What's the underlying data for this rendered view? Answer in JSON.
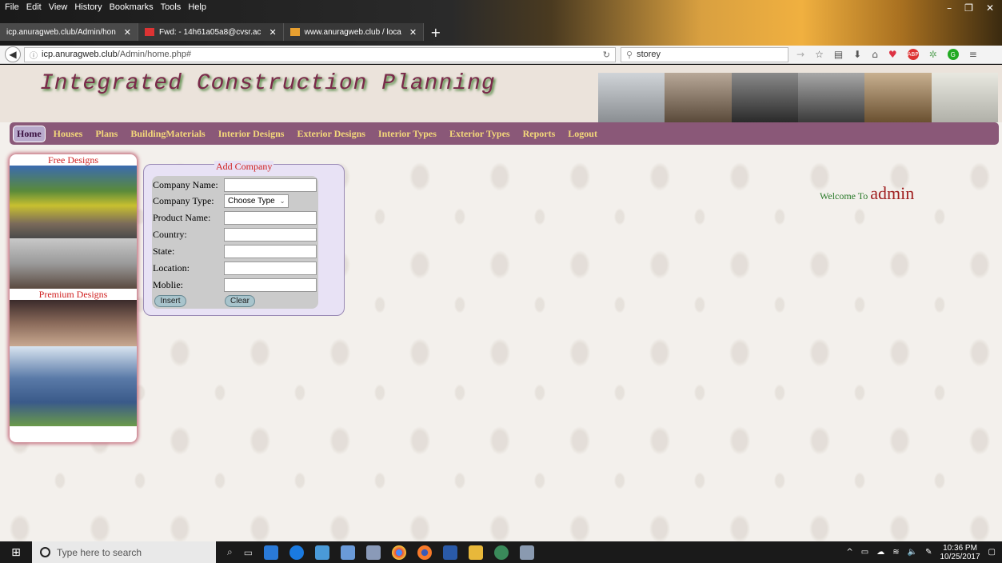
{
  "browser": {
    "menu": [
      "File",
      "Edit",
      "View",
      "History",
      "Bookmarks",
      "Tools",
      "Help"
    ],
    "tabs": [
      {
        "label": "icp.anuragweb.club/Admin/hon",
        "active": true
      },
      {
        "label": "Fwd: - 14h61a05a8@cvsr.ac",
        "active": false
      },
      {
        "label": "www.anuragweb.club / loca",
        "active": false
      }
    ],
    "new_tab": "+",
    "url_host": "icp.anuragweb.club",
    "url_path": "/Admin/home.php#",
    "search_value": "storey"
  },
  "site": {
    "title": "Integrated Construction Planning",
    "nav": [
      {
        "label": "Home",
        "current": true
      },
      {
        "label": "Houses"
      },
      {
        "label": "Plans"
      },
      {
        "label": "BuildingMaterials"
      },
      {
        "label": "Interior Designs"
      },
      {
        "label": "Exterior Designs"
      },
      {
        "label": "Interior Types"
      },
      {
        "label": "Exterior Types"
      },
      {
        "label": "Reports"
      },
      {
        "label": "Logout"
      }
    ],
    "sidebar": {
      "free_title": "Free Designs",
      "premium_title": "Premium Designs"
    },
    "form": {
      "legend": "Add Company",
      "fields": {
        "company_name": "Company Name:",
        "company_type": "Company Type:",
        "product_name": "Product Name:",
        "country": "Country:",
        "state": "State:",
        "location": "Location:",
        "mobile": "Moblie:"
      },
      "company_type_selected": "Choose Type",
      "insert_label": "Insert",
      "clear_label": "Clear"
    },
    "welcome": {
      "prefix": "Welcome To",
      "user": "admin"
    }
  },
  "taskbar": {
    "search_placeholder": "Type here to search",
    "time": "10:36 PM",
    "date": "10/25/2017"
  }
}
